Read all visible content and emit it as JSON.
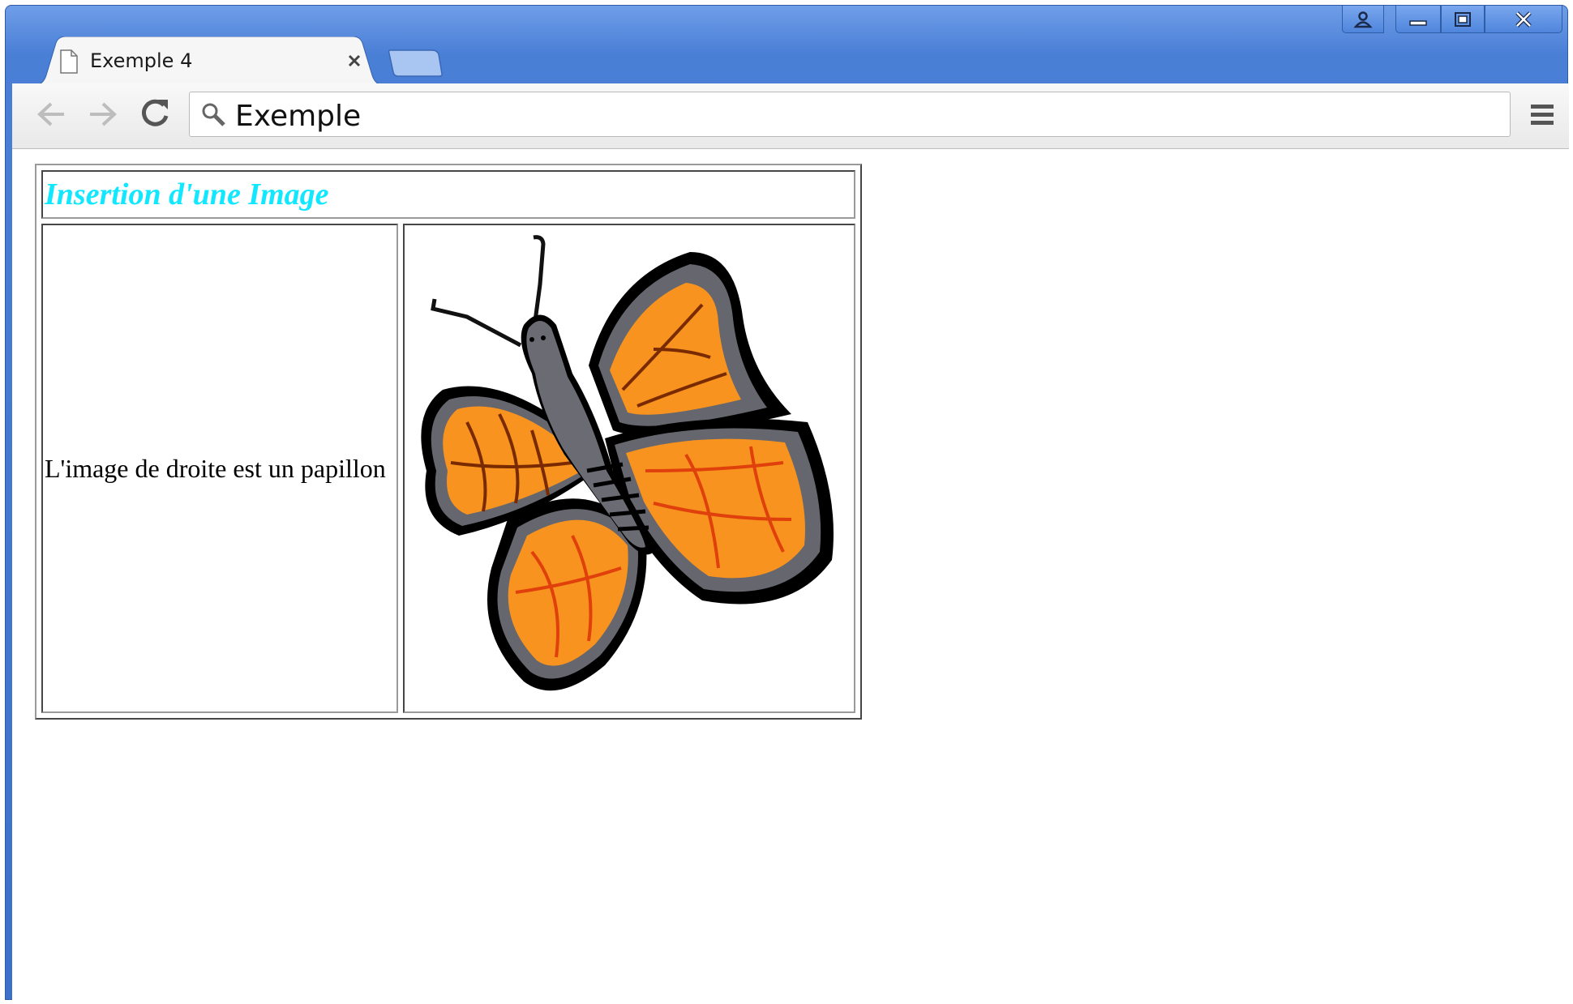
{
  "browser": {
    "tab": {
      "title": "Exemple 4",
      "icon": "document-icon"
    },
    "address_bar": {
      "value": "Exemple",
      "icon": "search-icon"
    }
  },
  "content": {
    "heading": "Insertion d'une Image",
    "description": "L'image de droite est un papillon",
    "image": {
      "subject": "butterfly-image"
    }
  },
  "colors": {
    "heading": "#11e8ff",
    "titlebar": "#4a7fd6",
    "wing": "#f7931e",
    "body": "#6b6b73"
  }
}
